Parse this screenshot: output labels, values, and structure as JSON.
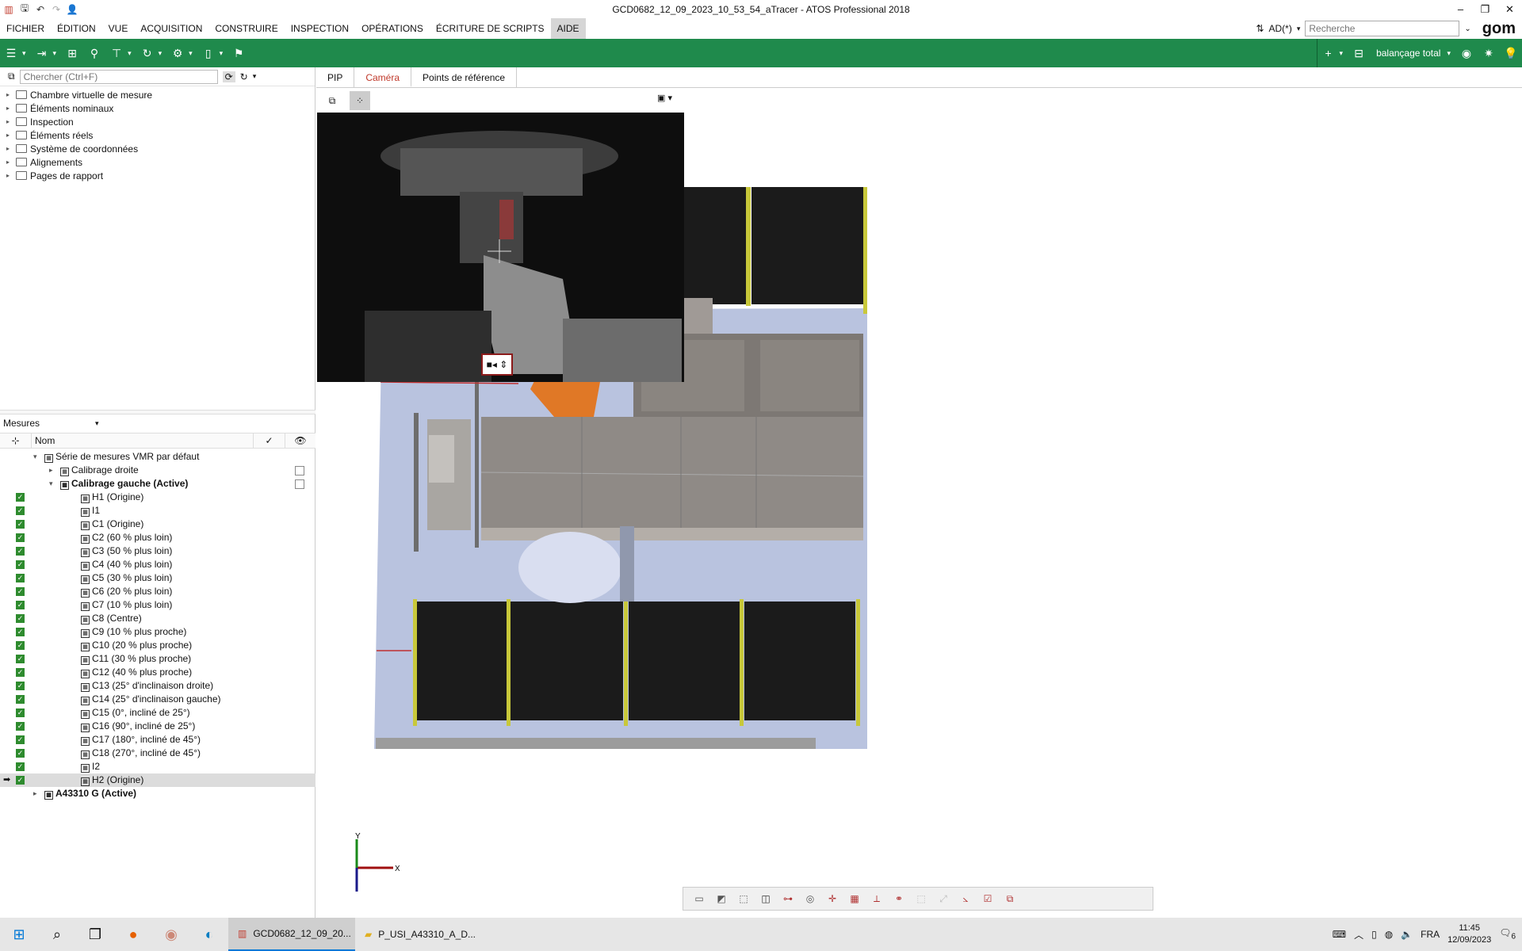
{
  "window": {
    "title": "GCD0682_12_09_2023_10_53_54_aTracer - ATOS Professional 2018"
  },
  "menu": {
    "items": [
      "FICHIER",
      "ÉDITION",
      "VUE",
      "ACQUISITION",
      "CONSTRUIRE",
      "INSPECTION",
      "OPÉRATIONS",
      "ÉCRITURE DE SCRIPTS",
      "AIDE"
    ],
    "user": "AD(*)",
    "search_placeholder": "Recherche",
    "brand": "gom"
  },
  "toolbar": {
    "alignment_label": "balançage total"
  },
  "explorer": {
    "search_placeholder": "Chercher (Ctrl+F)",
    "items": [
      "Chambre virtuelle de mesure",
      "Éléments nominaux",
      "Inspection",
      "Éléments réels",
      "Système de coordonnées",
      "Alignements",
      "Pages de rapport"
    ]
  },
  "measurements": {
    "title": "Mesures",
    "col_name": "Nom",
    "rows": [
      {
        "label": "Série de mesures VMR par défaut",
        "indent": 0,
        "check": false,
        "box": false,
        "bold": false,
        "sel": false,
        "exp": "▾"
      },
      {
        "label": "Calibrage droite",
        "indent": 1,
        "check": false,
        "box": true,
        "bold": false,
        "sel": false,
        "exp": "▸"
      },
      {
        "label": "Calibrage gauche (Active)",
        "indent": 1,
        "check": false,
        "box": true,
        "bold": true,
        "sel": false,
        "exp": "▾"
      },
      {
        "label": "H1 (Origine)",
        "indent": 2,
        "check": true,
        "box": false,
        "bold": false,
        "sel": false,
        "exp": ""
      },
      {
        "label": "I1",
        "indent": 2,
        "check": true,
        "box": false,
        "bold": false,
        "sel": false,
        "exp": ""
      },
      {
        "label": "C1 (Origine)",
        "indent": 2,
        "check": true,
        "box": false,
        "bold": false,
        "sel": false,
        "exp": ""
      },
      {
        "label": "C2 (60 % plus loin)",
        "indent": 2,
        "check": true,
        "box": false,
        "bold": false,
        "sel": false,
        "exp": ""
      },
      {
        "label": "C3 (50 % plus loin)",
        "indent": 2,
        "check": true,
        "box": false,
        "bold": false,
        "sel": false,
        "exp": ""
      },
      {
        "label": "C4 (40 % plus loin)",
        "indent": 2,
        "check": true,
        "box": false,
        "bold": false,
        "sel": false,
        "exp": ""
      },
      {
        "label": "C5 (30 % plus loin)",
        "indent": 2,
        "check": true,
        "box": false,
        "bold": false,
        "sel": false,
        "exp": ""
      },
      {
        "label": "C6 (20 % plus loin)",
        "indent": 2,
        "check": true,
        "box": false,
        "bold": false,
        "sel": false,
        "exp": ""
      },
      {
        "label": "C7 (10 % plus loin)",
        "indent": 2,
        "check": true,
        "box": false,
        "bold": false,
        "sel": false,
        "exp": ""
      },
      {
        "label": "C8 (Centre)",
        "indent": 2,
        "check": true,
        "box": false,
        "bold": false,
        "sel": false,
        "exp": ""
      },
      {
        "label": "C9 (10 % plus proche)",
        "indent": 2,
        "check": true,
        "box": false,
        "bold": false,
        "sel": false,
        "exp": ""
      },
      {
        "label": "C10 (20 % plus proche)",
        "indent": 2,
        "check": true,
        "box": false,
        "bold": false,
        "sel": false,
        "exp": ""
      },
      {
        "label": "C11 (30 % plus proche)",
        "indent": 2,
        "check": true,
        "box": false,
        "bold": false,
        "sel": false,
        "exp": ""
      },
      {
        "label": "C12 (40 % plus proche)",
        "indent": 2,
        "check": true,
        "box": false,
        "bold": false,
        "sel": false,
        "exp": ""
      },
      {
        "label": "C13 (25° d'inclinaison droite)",
        "indent": 2,
        "check": true,
        "box": false,
        "bold": false,
        "sel": false,
        "exp": ""
      },
      {
        "label": "C14 (25° d'inclinaison gauche)",
        "indent": 2,
        "check": true,
        "box": false,
        "bold": false,
        "sel": false,
        "exp": ""
      },
      {
        "label": "C15 (0°, incliné de 25°)",
        "indent": 2,
        "check": true,
        "box": false,
        "bold": false,
        "sel": false,
        "exp": ""
      },
      {
        "label": "C16 (90°, incliné de 25°)",
        "indent": 2,
        "check": true,
        "box": false,
        "bold": false,
        "sel": false,
        "exp": ""
      },
      {
        "label": "C17 (180°, incliné de 45°)",
        "indent": 2,
        "check": true,
        "box": false,
        "bold": false,
        "sel": false,
        "exp": ""
      },
      {
        "label": "C18 (270°, incliné de 45°)",
        "indent": 2,
        "check": true,
        "box": false,
        "bold": false,
        "sel": false,
        "exp": ""
      },
      {
        "label": "I2",
        "indent": 2,
        "check": true,
        "box": false,
        "bold": false,
        "sel": false,
        "exp": ""
      },
      {
        "label": "H2 (Origine)",
        "indent": 2,
        "check": true,
        "box": false,
        "bold": false,
        "sel": true,
        "exp": ""
      },
      {
        "label": "A43310 G (Active)",
        "indent": 0,
        "check": false,
        "box": false,
        "bold": true,
        "sel": false,
        "exp": "▸"
      }
    ]
  },
  "tabs": [
    "PIP",
    "Caméra",
    "Points de référence"
  ],
  "axes": {
    "x": "X",
    "y": "Y"
  },
  "taskbar": {
    "tasks": [
      "GCD0682_12_09_20...",
      "P_USI_A43310_A_D..."
    ],
    "lang": "FRA",
    "time": "11:45",
    "date": "12/09/2023",
    "notif": "6"
  },
  "colors": {
    "accent": "#1f8a4c",
    "active_tab": "#c0392b"
  }
}
